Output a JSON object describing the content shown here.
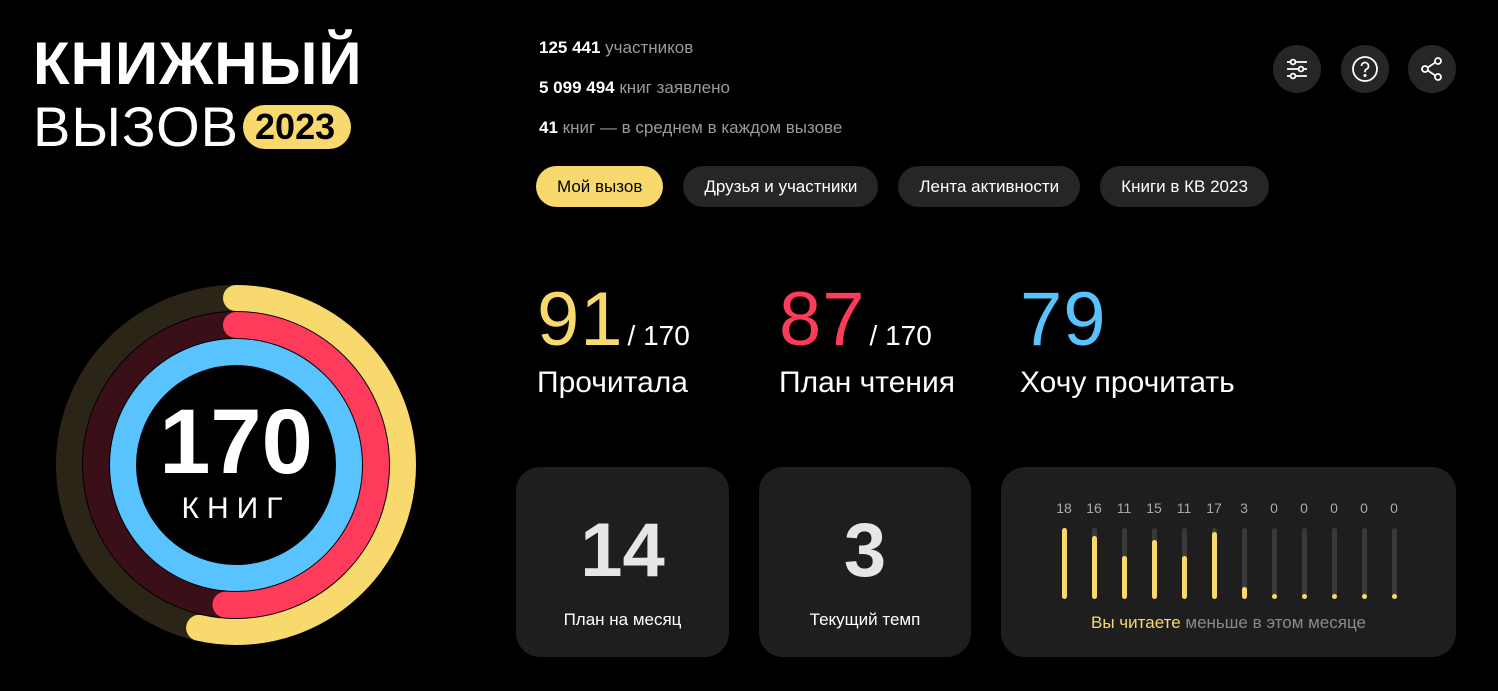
{
  "logo": {
    "line1": "КНИЖНЫЙ",
    "line2": "ВЫЗОВ",
    "year": "2023"
  },
  "stats": [
    {
      "value": "125 441",
      "text": " участников"
    },
    {
      "value": "5 099 494",
      "text": " книг заявлено"
    },
    {
      "value": "41",
      "text": " книг — в среднем в каждом вызове"
    }
  ],
  "tabs": [
    {
      "label": "Мой вызов",
      "active": true
    },
    {
      "label": "Друзья и участники",
      "active": false
    },
    {
      "label": "Лента активности",
      "active": false
    },
    {
      "label": "Книги в КВ 2023",
      "active": false
    }
  ],
  "toolbar": {
    "icons": [
      "filter-settings-icon",
      "help-icon",
      "share-icon"
    ]
  },
  "goal": {
    "number": "170",
    "unit": "КНИГ"
  },
  "metrics": {
    "read": {
      "value": "91",
      "of": "/ 170",
      "label": "Прочитала",
      "color": "#f7d96e"
    },
    "plan": {
      "value": "87",
      "of": "/ 170",
      "label": "План чтения",
      "color": "#ff3b5c"
    },
    "want": {
      "value": "79",
      "label": "Хочу прочитать",
      "color": "#59c3ff"
    }
  },
  "cards": {
    "monthly_plan": {
      "value": "14",
      "label": "План на месяц"
    },
    "current_pace": {
      "value": "3",
      "label": "Текущий темп"
    }
  },
  "monthly": {
    "counts": [
      "18",
      "16",
      "11",
      "15",
      "11",
      "17",
      "3",
      "0",
      "0",
      "0",
      "0",
      "0"
    ],
    "note_highlight": "Вы читаете",
    "note_rest": " меньше в этом месяце"
  },
  "colors": {
    "accent": "#f7d96e",
    "plan": "#ff3b5c",
    "want": "#59c3ff",
    "card": "#1e1e1e"
  }
}
